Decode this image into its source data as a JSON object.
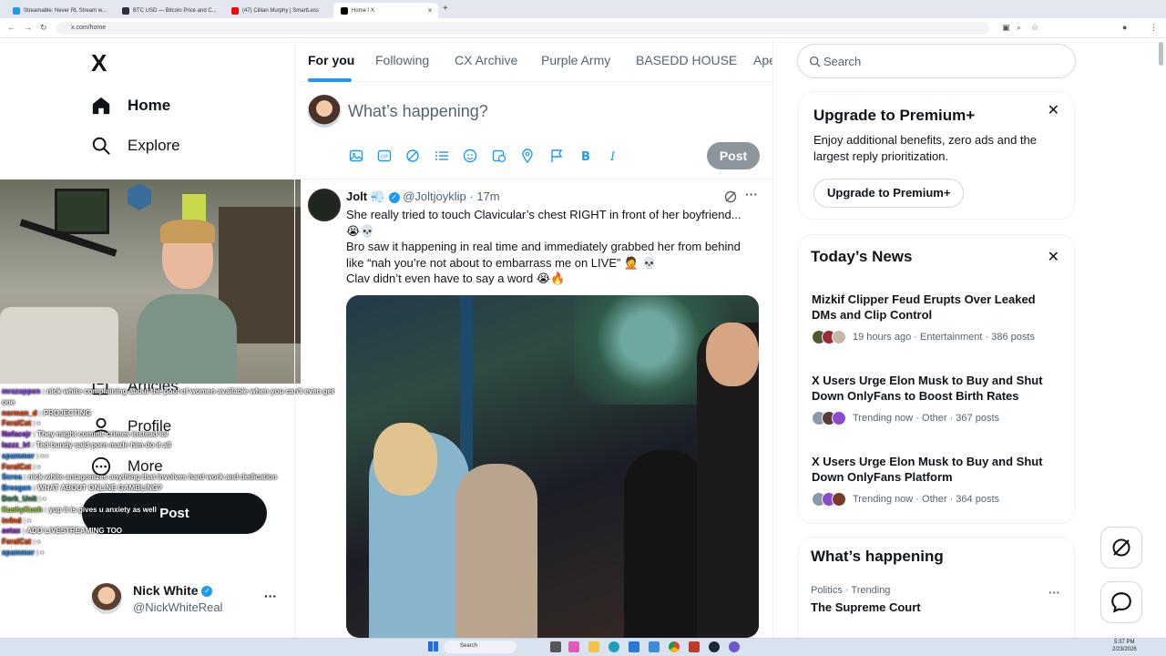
{
  "browser": {
    "tabs": [
      {
        "title": "Streamable: Never RL Stream w...",
        "color": "#1d9bf0"
      },
      {
        "title": "BTC USD — Bitcoin Price and C...",
        "color": "#2a2e39"
      },
      {
        "title": "(47) Cillian Murphy | SmartLess",
        "color": "#ff0000"
      },
      {
        "title": "Home / X",
        "color": "#000000"
      }
    ],
    "url": "x.com/home"
  },
  "sidebar": {
    "logo": "X",
    "items": [
      {
        "label": "Home",
        "icon": "home-icon"
      },
      {
        "label": "Explore",
        "icon": "search-icon"
      },
      {
        "label": "Articles",
        "icon": "article-icon"
      },
      {
        "label": "Profile",
        "icon": "person-icon"
      },
      {
        "label": "More",
        "icon": "more-circle-icon"
      }
    ],
    "post_button": "Post",
    "account": {
      "name": "Nick White",
      "handle": "@NickWhiteReal",
      "more": "···"
    }
  },
  "feed": {
    "tabs": [
      "For you",
      "Following",
      "CX Archive",
      "Purple Army",
      "BASEDD HOUSE",
      "Ape"
    ],
    "selected_tab": "For you",
    "composer_placeholder": "What’s happening?",
    "composer_post": "Post",
    "tweet": {
      "name": "Jolt",
      "name_emoji": "💨",
      "handle": "@Joltjoyklip",
      "time": "· 17m",
      "lines": [
        "She really tried to touch Clavicular’s chest RIGHT in front of her boyfriend...",
        "😭💀",
        "Bro saw it happening in real time and immediately grabbed her from behind",
        "like “nah you’re not about to embarrass me on LIVE” 🤦 💀",
        "Clav didn’t even have to say a word 😭🔥"
      ]
    }
  },
  "right": {
    "search_placeholder": "Search",
    "premium": {
      "title": "Upgrade to Premium+",
      "body": "Enjoy additional benefits, zero ads and the largest reply prioritization.",
      "button": "Upgrade to Premium+"
    },
    "news": {
      "title": "Today’s News",
      "items": [
        {
          "headline": "Mizkif Clipper Feud Erupts Over Leaked DMs and Clip Control",
          "meta": "19 hours ago · Entertainment · 386 posts"
        },
        {
          "headline": "X Users Urge Elon Musk to Buy and Shut Down OnlyFans to Boost Birth Rates",
          "meta": "Trending now · Other · 367 posts"
        },
        {
          "headline": "X Users Urge Elon Musk to Buy and Shut Down OnlyFans Platform",
          "meta": "Trending now · Other · 364 posts"
        }
      ]
    },
    "happening": {
      "title": "What’s happening",
      "item_meta": "Politics · Trending",
      "item_title": "The Supreme Court"
    }
  },
  "chat": [
    {
      "user": "mrazappen",
      "color": "#9146ff",
      "msg": "nick white complaining about the pool of women available when you can't even get one"
    },
    {
      "user": "norman_d",
      "color": "#ff4500",
      "msg": "PROJECTING"
    },
    {
      "user": "FeralCat",
      "color": "#ff4500",
      "msg": "▪"
    },
    {
      "user": "Nofacejr",
      "color": "#8a2be2",
      "msg": "They might commit crimes instead lol"
    },
    {
      "user": "lazzz_lrl",
      "color": "#8a2be2",
      "msg": "Ted bundy said porn made him do it all"
    },
    {
      "user": "spammer",
      "color": "#1e90ff",
      "msg": "▪ ▪"
    },
    {
      "user": "FeralCat",
      "color": "#ff4500",
      "msg": "▪"
    },
    {
      "user": "Screa",
      "color": "#1e90ff",
      "msg": "nick white antagonizes anything that involves hard work and dedication"
    },
    {
      "user": "Breegen",
      "color": "#1e90ff",
      "msg": "WHAT ABOUT ONLINE GAMBLING?"
    },
    {
      "user": "Dork_Unit",
      "color": "#2e8b57",
      "msg": "▪"
    },
    {
      "user": "KushyKush",
      "color": "#9acd32",
      "msg": "yup it is gives u anxiety as well"
    },
    {
      "user": "in4nd",
      "color": "#ff4500",
      "msg": "▪"
    },
    {
      "user": "aetax",
      "color": "#8a2be2",
      "msg": "ADD LIVESTREAMING TOO"
    },
    {
      "user": "FeralCat",
      "color": "#ff4500",
      "msg": "▪"
    },
    {
      "user": "spammer",
      "color": "#1e90ff",
      "msg": "▪"
    }
  ],
  "taskbar": {
    "search": "Search",
    "time": "5:37 PM",
    "date": "2/23/2026"
  },
  "colors": {
    "accent": "#1d9bf0",
    "text": "#0f1419",
    "muted": "#536471"
  }
}
